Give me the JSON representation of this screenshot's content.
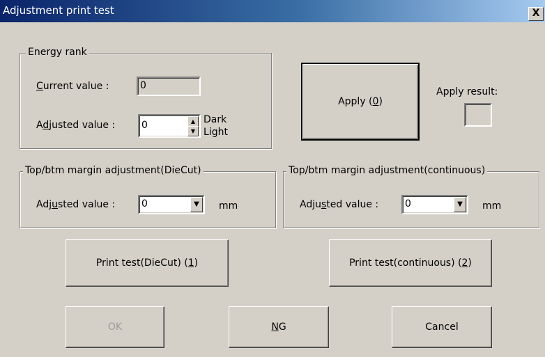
{
  "window": {
    "title": "Adjustment print test",
    "close_label": "X"
  },
  "energy_rank": {
    "legend": "Energy rank",
    "current_label_pre": "",
    "current_label_acc": "C",
    "current_label_post": "urrent value :",
    "current_value": "0",
    "adjusted_label_pre": "A",
    "adjusted_label_acc": "d",
    "adjusted_label_post": "justed value :",
    "adjusted_value": "0",
    "dark_label": "Dark",
    "light_label": "Light"
  },
  "apply": {
    "button_pre": "Apply (",
    "button_acc": "0",
    "button_post": ")",
    "result_label": "Apply result:"
  },
  "diecut_group": {
    "legend": "Top/btm margin adjustment(DieCut)",
    "label_pre": "Adj",
    "label_acc": "u",
    "label_post": "sted value :",
    "value": "0",
    "unit": "mm"
  },
  "continuous_group": {
    "legend": "Top/btm margin adjustment(continuous)",
    "label_pre": "Adju",
    "label_acc": "s",
    "label_post": "ted value :",
    "value": "0",
    "unit": "mm"
  },
  "print_diecut": {
    "pre": "Print test(DieCut) (",
    "acc": "1",
    "post": ")"
  },
  "print_continuous": {
    "pre": "Print test(continuous) (",
    "acc": "2",
    "post": ")"
  },
  "footer": {
    "ok_label": "OK",
    "ng_acc": "N",
    "ng_post": "G",
    "cancel_label": "Cancel"
  }
}
